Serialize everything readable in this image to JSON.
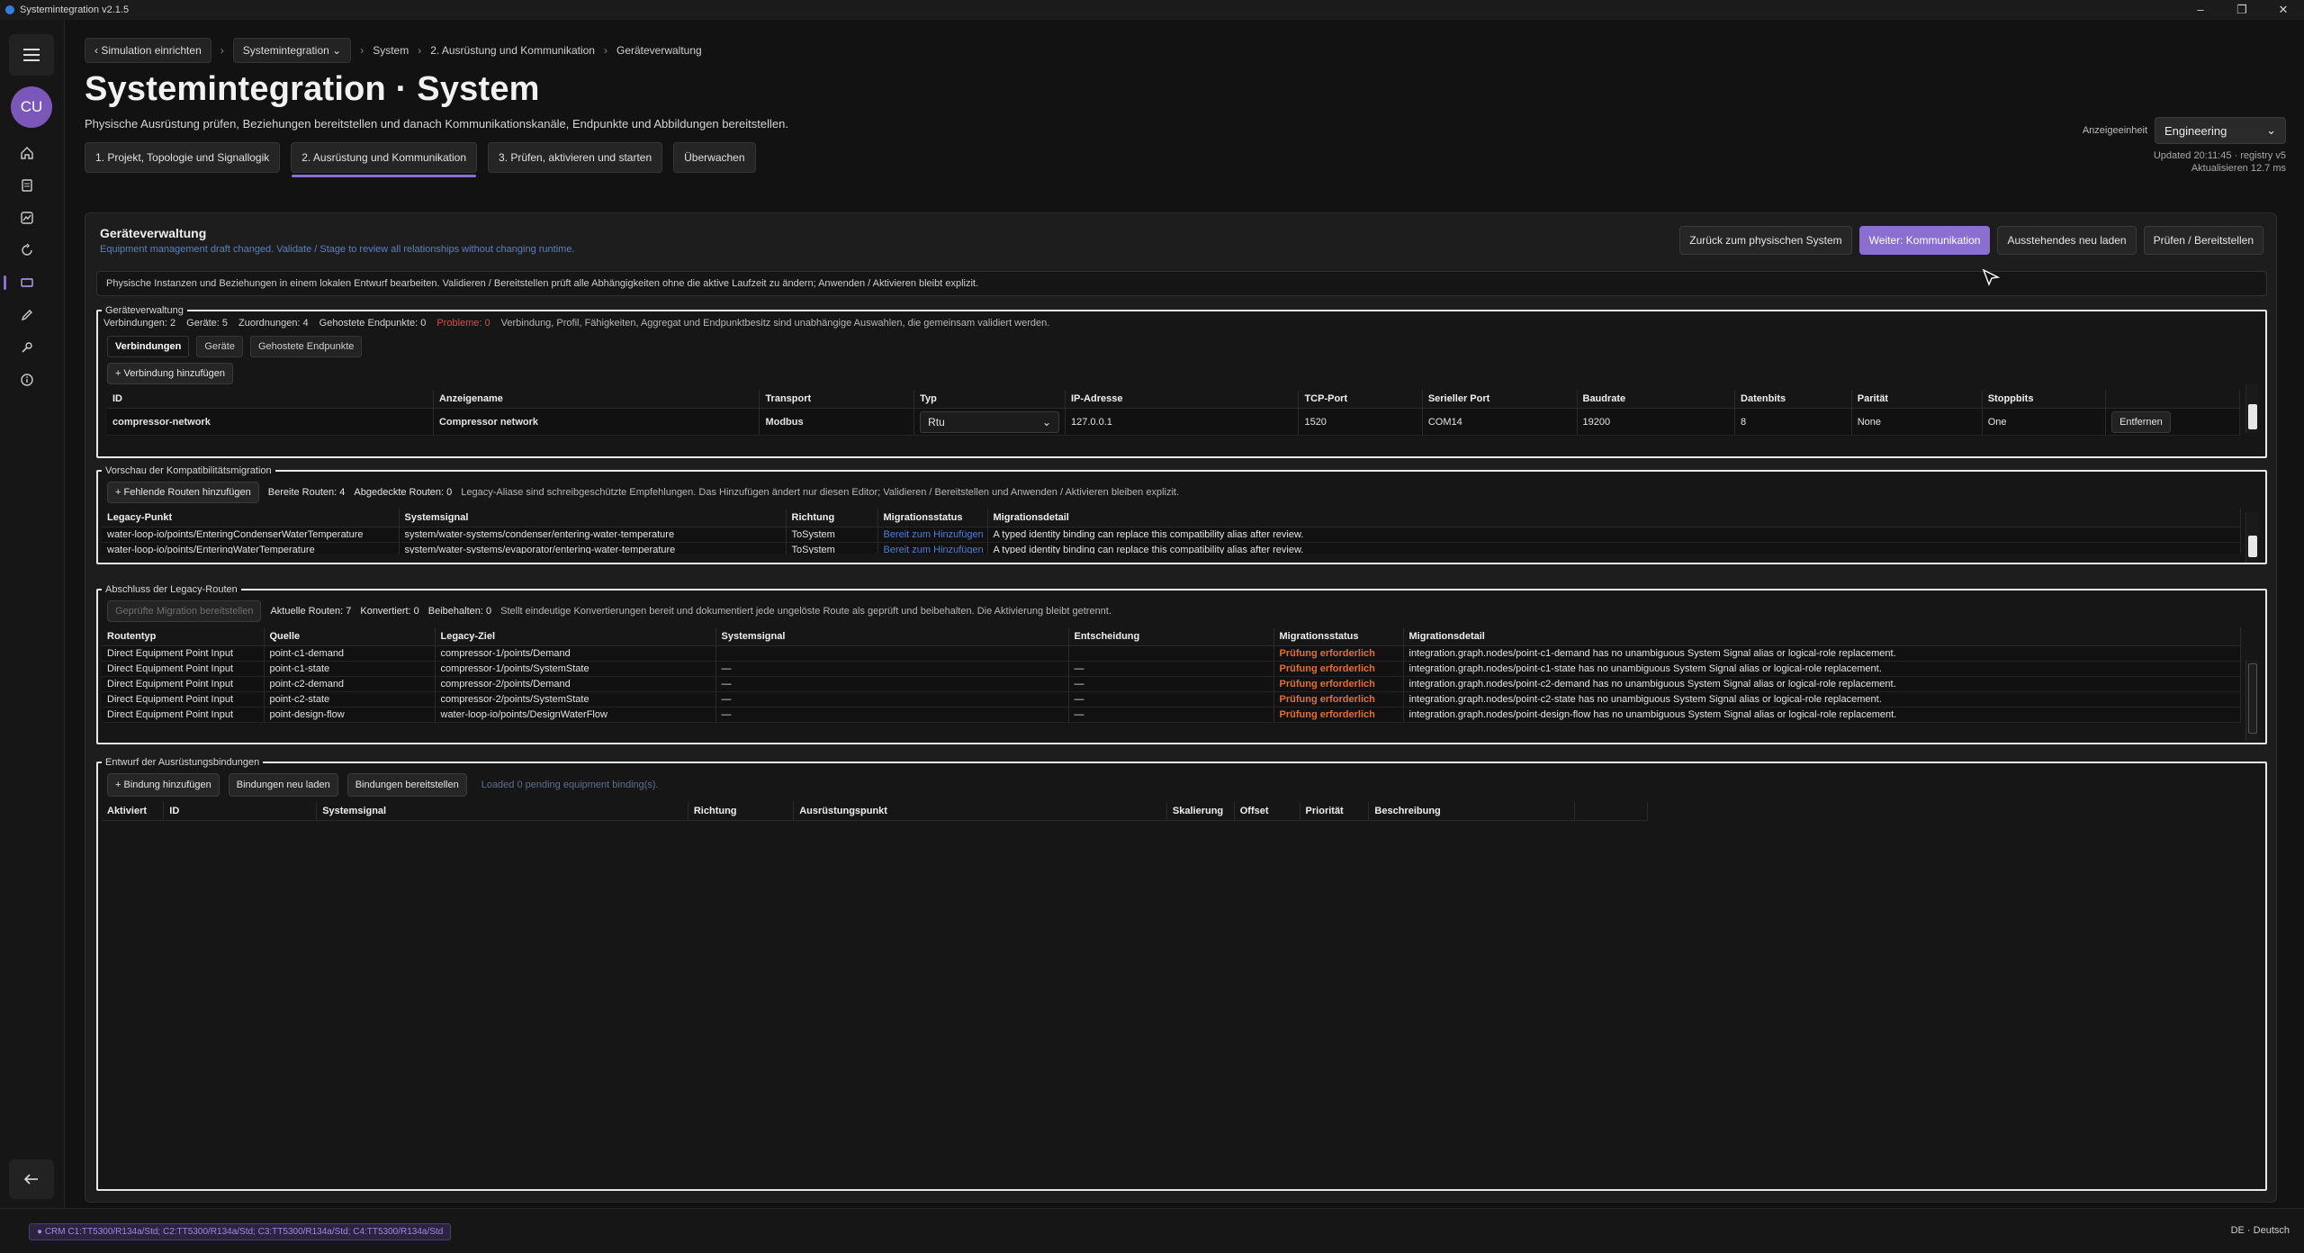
{
  "window": {
    "title": "Systemintegration v2.1.5",
    "controls": [
      "–",
      "❐",
      "✕"
    ]
  },
  "rail": {
    "avatar": "CU"
  },
  "breadcrumb": {
    "back_label": "Simulation einrichten",
    "context_label": "Systemintegration",
    "items": [
      "System",
      "2. Ausrüstung und Kommunikation",
      "Geräteverwaltung"
    ]
  },
  "header": {
    "title": "Systemintegration · System",
    "subtitle": "Physische Ausrüstung prüfen, Beziehungen bereitstellen und danach Kommunikationskanäle, Endpunkte und Abbildungen bereitstellen.",
    "steps": [
      "1. Projekt, Topologie und Signallogik",
      "2. Ausrüstung und Kommunikation",
      "3. Prüfen, aktivieren und starten",
      "Überwachen"
    ],
    "unit_label": "Anzeigeeinheit",
    "unit_value": "Engineering",
    "updated": "Updated 20:11:45 · registry v5",
    "refresh": "Aktualisieren 12.7 ms"
  },
  "panel": {
    "title": "Geräteverwaltung",
    "note": "Equipment management draft changed. Validate / Stage to review all relationships without changing runtime.",
    "actions": [
      "Zurück zum physischen System",
      "Weiter: Kommunikation",
      "Ausstehendes neu laden",
      "Prüfen / Bereitstellen"
    ],
    "info": "Physische Instanzen und Beziehungen in einem lokalen Entwurf bearbeiten. Validieren / Bereitstellen prüft alle Abhängigkeiten ohne die aktive Laufzeit zu ändern; Anwenden / Aktivieren bleibt explizit."
  },
  "devices": {
    "legend": "Geräteverwaltung",
    "stats": [
      "Verbindungen: 2",
      "Geräte: 5",
      "Zuordnungen: 4",
      "Gehostete Endpunkte: 0"
    ],
    "problems": "Probleme: 0",
    "stats_note": "Verbindung, Profil, Fähigkeiten, Aggregat und Endpunktbesitz sind unabhängige Auswahlen, die gemeinsam validiert werden.",
    "tabs": [
      "Verbindungen",
      "Geräte",
      "Gehostete Endpunkte"
    ],
    "add_button": "+ Verbindung hinzufügen",
    "columns": [
      "ID",
      "Anzeigename",
      "Transport",
      "Typ",
      "IP-Adresse",
      "TCP-Port",
      "Serieller Port",
      "Baudrate",
      "Datenbits",
      "Parität",
      "Stoppbits",
      ""
    ],
    "row": {
      "id": "compressor-network",
      "name": "Compressor network",
      "transport": "Modbus",
      "type": "Rtu",
      "ip": "127.0.0.1",
      "tcp_port": "1520",
      "serial_port": "COM14",
      "baud": "19200",
      "databits": "8",
      "parity": "None",
      "stopbits": "One",
      "remove": "Entfernen"
    }
  },
  "compat": {
    "legend": "Vorschau der Kompatibilitätsmigration",
    "add_button": "+ Fehlende Routen hinzufügen",
    "stats": [
      "Bereite Routen: 4",
      "Abgedeckte Routen: 0"
    ],
    "note": "Legacy-Aliase sind schreibgeschützte Empfehlungen. Das Hinzufügen ändert nur diesen Editor; Validieren / Bereitstellen und Anwenden / Aktivieren bleiben explizit.",
    "columns": [
      "Legacy-Punkt",
      "Systemsignal",
      "Richtung",
      "Migrationsstatus",
      "Migrationsdetail"
    ],
    "rows": [
      [
        "water-loop-io/points/EnteringCondenserWaterTemperature",
        "system/water-systems/condenser/entering-water-temperature",
        "ToSystem",
        "Bereit zum Hinzufügen",
        "A typed identity binding can replace this compatibility alias after review."
      ],
      [
        "water-loop-io/points/EnteringWaterTemperature",
        "system/water-systems/evaporator/entering-water-temperature",
        "ToSystem",
        "Bereit zum Hinzufügen",
        "A typed identity binding can replace this compatibility alias after review."
      ]
    ]
  },
  "legacy": {
    "legend": "Abschluss der Legacy-Routen",
    "button": "Geprüfte Migration bereitstellen",
    "stats": [
      "Aktuelle Routen: 7",
      "Konvertiert: 0",
      "Beibehalten: 0"
    ],
    "note": "Stellt eindeutige Konvertierungen bereit und dokumentiert jede ungelöste Route als geprüft und beibehalten. Die Aktivierung bleibt getrennt.",
    "columns": [
      "Routentyp",
      "Quelle",
      "Legacy-Ziel",
      "Systemsignal",
      "Entscheidung",
      "Migrationsstatus",
      "Migrationsdetail"
    ],
    "rows": [
      [
        "Direct Equipment Point Input",
        "point-c1-demand",
        "compressor-1/points/Demand",
        "",
        "",
        "Prüfung erforderlich",
        "integration.graph.nodes/point-c1-demand has no unambiguous System Signal alias or logical-role replacement."
      ],
      [
        "Direct Equipment Point Input",
        "point-c1-state",
        "compressor-1/points/SystemState",
        "—",
        "—",
        "Prüfung erforderlich",
        "integration.graph.nodes/point-c1-state has no unambiguous System Signal alias or logical-role replacement."
      ],
      [
        "Direct Equipment Point Input",
        "point-c2-demand",
        "compressor-2/points/Demand",
        "—",
        "—",
        "Prüfung erforderlich",
        "integration.graph.nodes/point-c2-demand has no unambiguous System Signal alias or logical-role replacement."
      ],
      [
        "Direct Equipment Point Input",
        "point-c2-state",
        "compressor-2/points/SystemState",
        "—",
        "—",
        "Prüfung erforderlich",
        "integration.graph.nodes/point-c2-state has no unambiguous System Signal alias or logical-role replacement."
      ],
      [
        "Direct Equipment Point Input",
        "point-design-flow",
        "water-loop-io/points/DesignWaterFlow",
        "—",
        "—",
        "Prüfung erforderlich",
        "integration.graph.nodes/point-design-flow has no unambiguous System Signal alias or logical-role replacement."
      ]
    ]
  },
  "bindings": {
    "legend": "Entwurf der Ausrüstungsbindungen",
    "buttons": [
      "+ Bindung hinzufügen",
      "Bindungen neu laden",
      "Bindungen bereitstellen"
    ],
    "loaded": "Loaded 0 pending equipment binding(s).",
    "columns": [
      "Aktiviert",
      "ID",
      "Systemsignal",
      "Richtung",
      "Ausrüstungspunkt",
      "Skalierung",
      "Offset",
      "Priorität",
      "Beschreibung",
      ""
    ]
  },
  "statusbar": {
    "chip": "● CRM C1:TT5300/R134a/Std; C2:TT5300/R134a/Std; C3:TT5300/R134a/Std; C4:TT5300/R134a/Std",
    "language": "DE · Deutsch"
  },
  "colors": {
    "accent": "#8a6fd1",
    "warning": "#e2702c",
    "error": "#d84a4a",
    "link": "#4d7fd6"
  }
}
